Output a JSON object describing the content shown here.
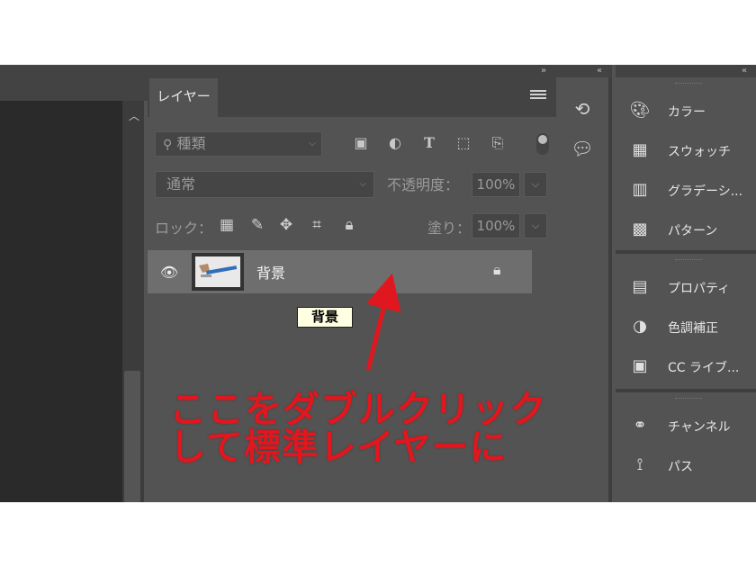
{
  "layers_panel": {
    "tab_label": "レイヤー",
    "collapse_glyph": "»",
    "menu_icon": "hamburger-menu-icon",
    "filter": {
      "value": "種類",
      "chevron": "⌵",
      "search_icon": "search-icon"
    },
    "filter_icons": [
      "image-filter-icon",
      "adjustment-filter-icon",
      "type-filter-icon",
      "shape-filter-icon",
      "smart-object-filter-icon"
    ],
    "blend_mode": "通常",
    "opacity_label": "不透明度：",
    "opacity_value": "100%",
    "lock_label": "ロック：",
    "lock_icons": [
      "lock-transparent-pixels-icon",
      "lock-image-pixels-icon",
      "lock-position-icon",
      "lock-artboard-icon",
      "lock-all-icon"
    ],
    "fill_label": "塗り：",
    "fill_value": "100%",
    "dropdown_glyph": "⌵",
    "layers": [
      {
        "name": "背景",
        "visible": true,
        "locked": true
      }
    ],
    "tooltip": "背景"
  },
  "mini_panel": {
    "collapse_glyph": "«",
    "icons": [
      "history-icon",
      "comment-icon"
    ]
  },
  "right_panels": {
    "collapse_glyph": "«",
    "groups": [
      [
        {
          "label": "カラー",
          "icon": "color-palette-icon"
        },
        {
          "label": "スウォッチ",
          "icon": "swatches-grid-icon"
        },
        {
          "label": "グラデーシ...",
          "icon": "gradient-icon"
        },
        {
          "label": "パターン",
          "icon": "pattern-icon"
        }
      ],
      [
        {
          "label": "プロパティ",
          "icon": "properties-icon"
        },
        {
          "label": "色調補正",
          "icon": "adjustments-icon"
        },
        {
          "label": "CC ライブ...",
          "icon": "cc-libraries-icon"
        }
      ],
      [
        {
          "label": "チャンネル",
          "icon": "channels-icon"
        },
        {
          "label": "パス",
          "icon": "paths-icon"
        }
      ]
    ]
  },
  "annotation": {
    "line1": "ここをダブルクリック",
    "line2": "して標準レイヤーに",
    "color": "#e0171e"
  },
  "colors": {
    "panel_bg": "#535353",
    "header_bg": "#434343",
    "canvas_bg": "#2a2a2a",
    "selected_layer": "#6e6e6e",
    "tooltip_bg": "#ffffe1"
  }
}
